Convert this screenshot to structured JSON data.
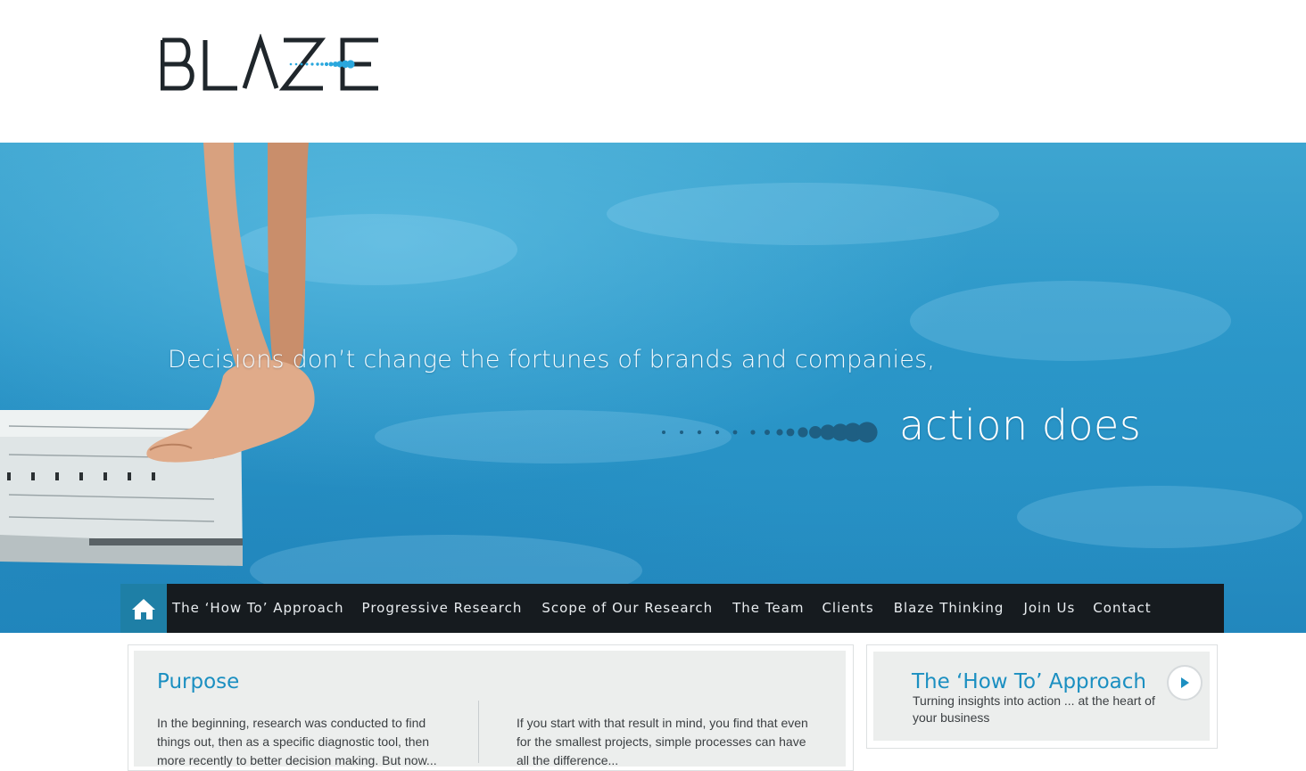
{
  "brand": {
    "logo_text": "BLAZE",
    "accent_color": "#1b8fc1",
    "dark_color": "#1f262b"
  },
  "hero": {
    "tagline_line1": "Decisions don’t change the fortunes of brands and companies,",
    "tagline_line2": "action does"
  },
  "nav": {
    "home_icon": "home-icon",
    "items": [
      {
        "label": "The ‘How To’ Approach"
      },
      {
        "label": "Progressive Research"
      },
      {
        "label": "Scope of Our Research"
      },
      {
        "label": "The Team"
      },
      {
        "label": "Clients"
      },
      {
        "label": "Blaze Thinking"
      },
      {
        "label": "Join Us"
      },
      {
        "label": "Contact"
      }
    ]
  },
  "purpose": {
    "title": "Purpose",
    "col1": "In the beginning, research was conducted to find things out, then as a specific diagnostic tool, then more recently to better decision making. But now...",
    "col2": "If you start with that result in mind, you find that even for the smallest projects, simple processes can have all the difference..."
  },
  "howto": {
    "title": "The ‘How To’ Approach",
    "subtitle": "Turning insights into action ... at the heart of your business",
    "play_icon": "play-icon"
  }
}
